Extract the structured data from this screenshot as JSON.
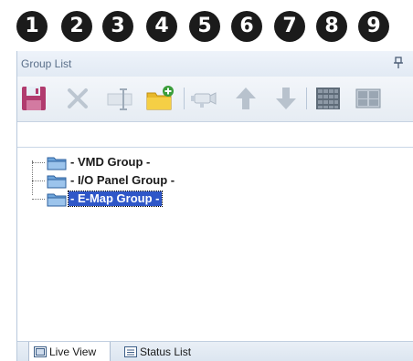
{
  "callouts": [
    "1",
    "2",
    "3",
    "4",
    "5",
    "6",
    "7",
    "8",
    "9"
  ],
  "panel": {
    "title": "Group List",
    "pin_icon": "pin-icon"
  },
  "toolbar": {
    "buttons": [
      {
        "icon": "save-icon",
        "enabled": true
      },
      {
        "icon": "delete-icon",
        "enabled": false
      },
      {
        "icon": "rename-icon",
        "enabled": false
      },
      {
        "icon": "new-folder-icon",
        "enabled": true
      },
      {
        "icon": "camera-icon",
        "enabled": false
      },
      {
        "icon": "move-up-icon",
        "enabled": false
      },
      {
        "icon": "move-down-icon",
        "enabled": false
      },
      {
        "icon": "grid-view-icon",
        "enabled": false
      },
      {
        "icon": "monitor-view-icon",
        "enabled": false
      }
    ]
  },
  "tree": {
    "items": [
      {
        "label": "- VMD Group -",
        "selected": false
      },
      {
        "label": "- I/O Panel Group -",
        "selected": false
      },
      {
        "label": "- E-Map Group -",
        "selected": true
      }
    ]
  },
  "tabs": [
    {
      "label": "Live View",
      "active": true
    },
    {
      "label": "Status List",
      "active": false
    }
  ],
  "colors": {
    "selection": "#2f57c8",
    "callout": "#1b1b1b",
    "folder_blue": "#3c7fc6"
  }
}
